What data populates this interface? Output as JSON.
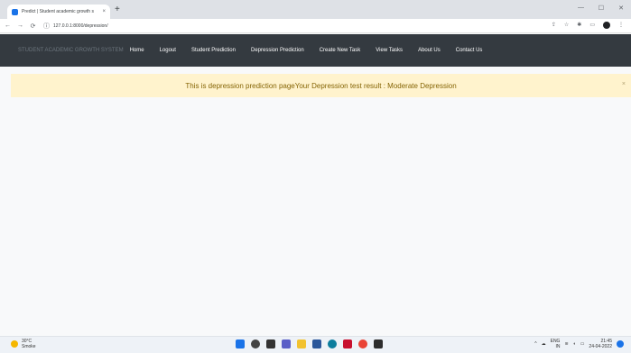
{
  "browser": {
    "tab_title": "Predict | Student academic growth s",
    "tab_close": "×",
    "new_tab": "+",
    "url": "127.0.0.1:8000/depression/",
    "controls": {
      "minimize": "—",
      "maximize": "☐",
      "close": "✕"
    }
  },
  "navbar": {
    "brand": "STUDENT ACADEMIC GROWTH SYSTEM",
    "links": [
      "Home",
      "Logout",
      "Student Prediction",
      "Depression Prediction",
      "Create New Task",
      "View Tasks",
      "About Us",
      "Contact Us"
    ]
  },
  "alert": {
    "message": "This is depression prediction pageYour Depression test result : Moderate Depression",
    "close": "×"
  },
  "taskbar": {
    "weather_temp": "30°C",
    "weather_desc": "Smoke",
    "lang_top": "ENG",
    "lang_bottom": "IN",
    "time": "21:45",
    "date": "24-04-2022"
  },
  "colors": {
    "navbar_bg": "#343a40",
    "alert_bg": "#fff3cd",
    "alert_text": "#856404"
  }
}
